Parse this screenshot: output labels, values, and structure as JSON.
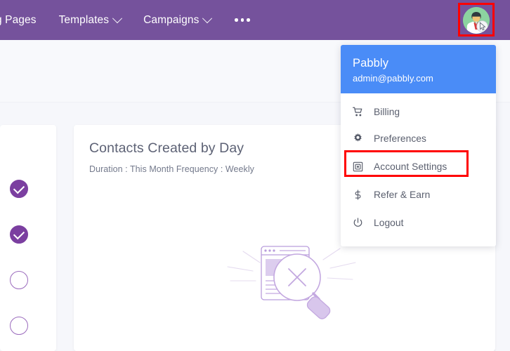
{
  "topnav": {
    "items": [
      {
        "label": "g Pages",
        "has_caret": false,
        "name": "nav-item-landing-pages"
      },
      {
        "label": "Templates",
        "has_caret": true,
        "name": "nav-item-templates"
      },
      {
        "label": "Campaigns",
        "has_caret": true,
        "name": "nav-item-campaigns"
      }
    ],
    "more_icon": "ellipsis-icon",
    "avatar_icon": "user-avatar-icon",
    "bar_color": "#75529c"
  },
  "account_dropdown": {
    "user_name": "Pabbly",
    "user_email": "admin@pabbly.com",
    "header_color": "#4a8cf7",
    "items": [
      {
        "label": "Billing",
        "icon": "shopping-cart-icon",
        "name": "menu-item-billing"
      },
      {
        "label": "Preferences",
        "icon": "gear-icon",
        "name": "menu-item-preferences"
      },
      {
        "label": "Account Settings",
        "icon": "account-settings-icon",
        "name": "menu-item-account-settings"
      },
      {
        "label": "Refer & Earn",
        "icon": "dollar-icon",
        "name": "menu-item-refer-earn"
      },
      {
        "label": "Logout",
        "icon": "power-icon",
        "name": "menu-item-logout"
      }
    ],
    "highlighted_item": "Account Settings",
    "highlight_color": "#ff0000"
  },
  "steps_panel": {
    "steps": [
      {
        "state": "done",
        "name": "step-indicator-1"
      },
      {
        "state": "done",
        "name": "step-indicator-2"
      },
      {
        "state": "todo",
        "name": "step-indicator-3"
      },
      {
        "state": "todo",
        "name": "step-indicator-4"
      }
    ],
    "done_color": "#7b3fa0",
    "todo_color": "#9b6bbd"
  },
  "chart_card": {
    "title": "Contacts Created by Day",
    "subtitle": "Duration : This Month Frequency : Weekly",
    "empty_state_icon": "no-data-magnifier-icon"
  },
  "chart_data": {
    "type": "bar",
    "title": "Contacts Created by Day",
    "subtitle": "Duration : This Month Frequency : Weekly",
    "categories": [],
    "values": [],
    "xlabel": "",
    "ylabel": "",
    "empty": true,
    "empty_message": ""
  }
}
